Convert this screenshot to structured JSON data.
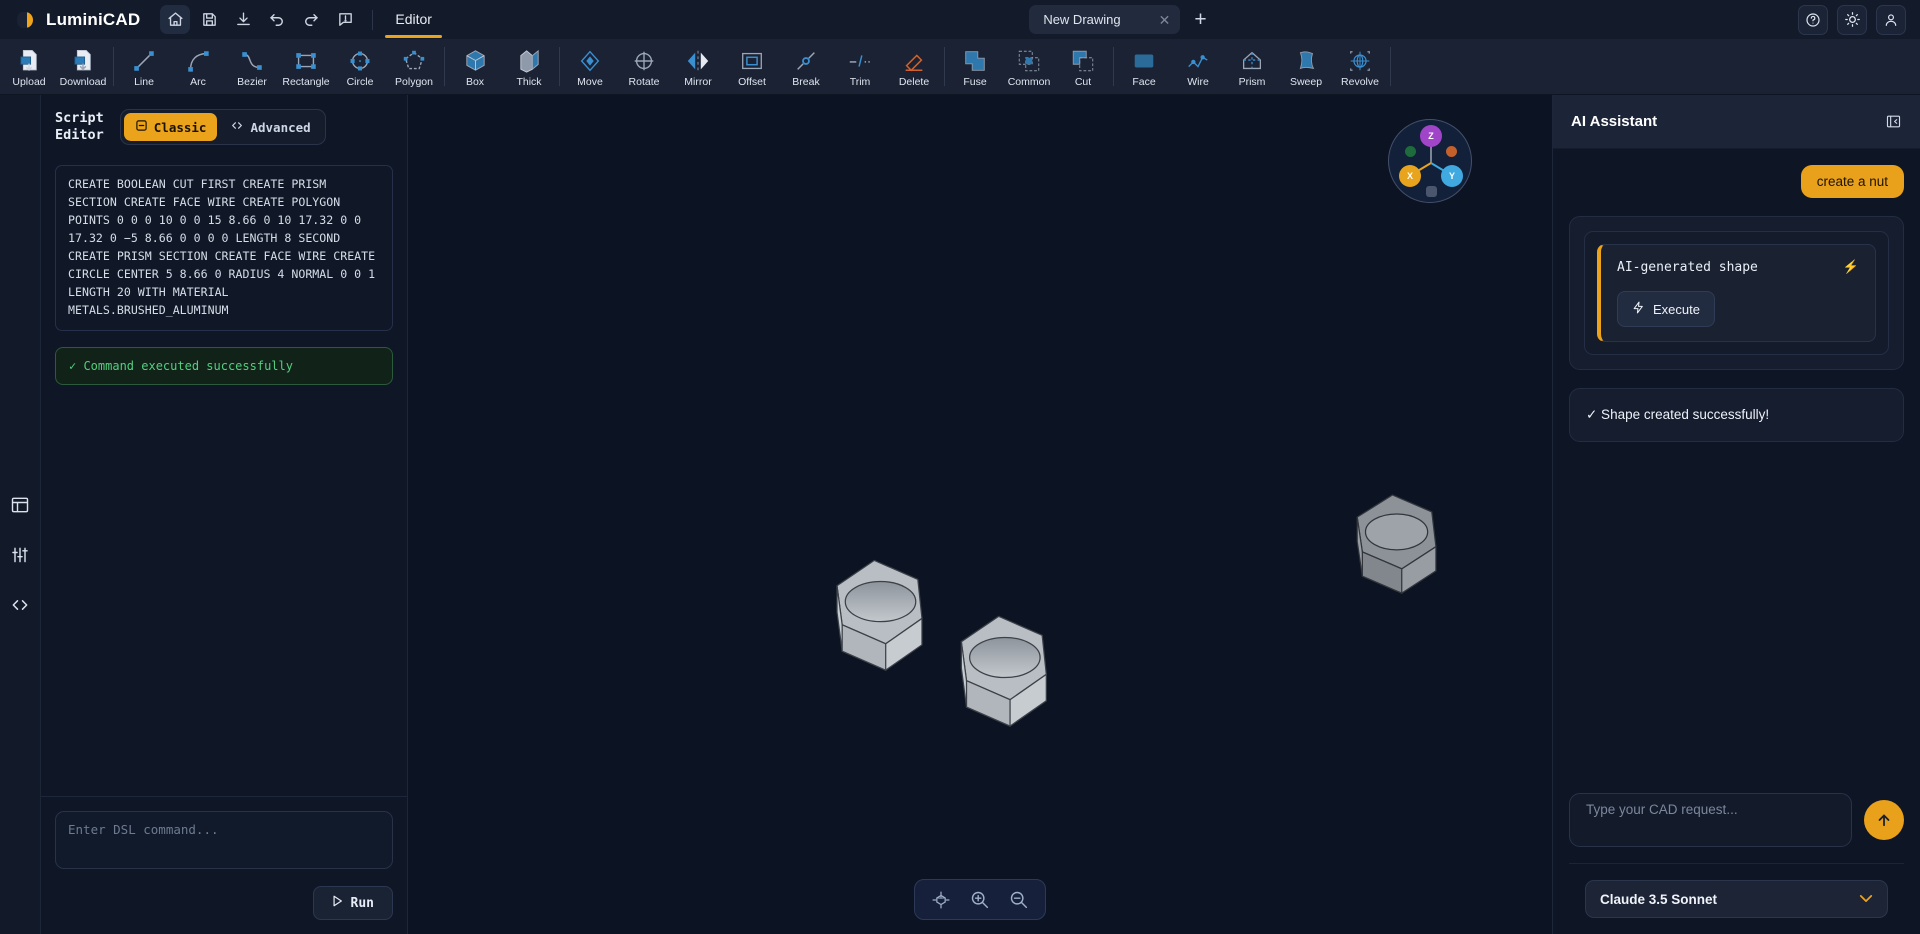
{
  "app": {
    "brand": "LuminiCAD",
    "accent": "#eba31b",
    "background": "#0d1320"
  },
  "topbar": {
    "icons": [
      {
        "name": "home-icon",
        "label": "Home"
      },
      {
        "name": "save-icon",
        "label": "Save"
      },
      {
        "name": "download-icon",
        "label": "Download"
      },
      {
        "name": "undo-icon",
        "label": "Undo"
      },
      {
        "name": "redo-icon",
        "label": "Redo"
      },
      {
        "name": "feedback-icon",
        "label": "Feedback"
      }
    ],
    "tab": "Editor",
    "document_tab": "New Drawing",
    "close_glyph": "✕",
    "new_tab_glyph": "+",
    "right_icons": [
      {
        "name": "help-icon",
        "label": "Help"
      },
      {
        "name": "theme-icon",
        "label": "Theme"
      },
      {
        "name": "account-icon",
        "label": "Account"
      }
    ]
  },
  "ribbon": {
    "groups": [
      {
        "items": [
          {
            "label": "Upload",
            "icon": "upload-icon"
          },
          {
            "label": "Download",
            "icon": "download-file-icon"
          }
        ]
      },
      {
        "items": [
          {
            "label": "Line",
            "icon": "line-icon"
          },
          {
            "label": "Arc",
            "icon": "arc-icon"
          },
          {
            "label": "Bezier",
            "icon": "bezier-icon"
          },
          {
            "label": "Rectangle",
            "icon": "rectangle-icon"
          },
          {
            "label": "Circle",
            "icon": "circle-icon"
          },
          {
            "label": "Polygon",
            "icon": "polygon-icon"
          }
        ]
      },
      {
        "items": [
          {
            "label": "Box",
            "icon": "box-icon"
          },
          {
            "label": "Thick",
            "icon": "thick-icon"
          }
        ]
      },
      {
        "items": [
          {
            "label": "Move",
            "icon": "move-icon"
          },
          {
            "label": "Rotate",
            "icon": "rotate-icon"
          },
          {
            "label": "Mirror",
            "icon": "mirror-icon"
          },
          {
            "label": "Offset",
            "icon": "offset-icon"
          },
          {
            "label": "Break",
            "icon": "break-icon"
          },
          {
            "label": "Trim",
            "icon": "trim-icon"
          },
          {
            "label": "Delete",
            "icon": "delete-icon"
          }
        ]
      },
      {
        "items": [
          {
            "label": "Fuse",
            "icon": "fuse-icon"
          },
          {
            "label": "Common",
            "icon": "common-icon"
          },
          {
            "label": "Cut",
            "icon": "cut-icon"
          }
        ]
      },
      {
        "items": [
          {
            "label": "Face",
            "icon": "face-icon"
          },
          {
            "label": "Wire",
            "icon": "wire-icon"
          },
          {
            "label": "Prism",
            "icon": "prism-icon"
          },
          {
            "label": "Sweep",
            "icon": "sweep-icon"
          },
          {
            "label": "Revolve",
            "icon": "revolve-icon"
          }
        ]
      }
    ]
  },
  "rail": {
    "items": [
      {
        "name": "layout-icon",
        "label": "Layout"
      },
      {
        "name": "sliders-icon",
        "label": "Properties"
      },
      {
        "name": "code-icon",
        "label": "Code"
      }
    ]
  },
  "script_editor": {
    "title": "Script\nEditor",
    "modes": [
      {
        "label": "Classic",
        "icon": "minus-box-icon",
        "active": true
      },
      {
        "label": "Advanced",
        "icon": "code-brackets-icon",
        "active": false
      }
    ],
    "script": "CREATE BOOLEAN CUT FIRST CREATE PRISM SECTION CREATE FACE WIRE CREATE POLYGON POINTS 0 0 0 10 0 0 15 8.66 0 10 17.32 0 0 17.32 0 −5 8.66 0 0 0 0 LENGTH 8 SECOND CREATE PRISM SECTION CREATE FACE WIRE CREATE CIRCLE CENTER 5 8.66 0 RADIUS 4 NORMAL 0 0 1 LENGTH 20 WITH MATERIAL METALS.BRUSHED_ALUMINUM",
    "status": "✓ Command executed successfully",
    "input_placeholder": "Enter DSL command...",
    "input_value": "",
    "run_label": "Run",
    "run_icon": "play-icon"
  },
  "viewport": {
    "gizmo": {
      "axes": [
        {
          "label": "Z",
          "color": "#a044c8"
        },
        {
          "label": "Y",
          "color": "#3fa9e0"
        },
        {
          "label": "X",
          "color": "#e8a41d"
        }
      ],
      "extra_dots": [
        {
          "color": "#1e6b3d"
        },
        {
          "color": "#c4602a"
        },
        {
          "color": "#49566d"
        }
      ]
    },
    "controls": [
      {
        "name": "fit-view-icon",
        "label": "Fit view"
      },
      {
        "name": "zoom-in-icon",
        "label": "Zoom in"
      },
      {
        "name": "zoom-out-icon",
        "label": "Zoom out"
      }
    ],
    "shapes_description": "three hexagonal nuts with circular through-holes"
  },
  "ai_panel": {
    "title": "AI Assistant",
    "collapse_icon": "collapse-panel-icon",
    "messages": [
      {
        "role": "user",
        "text": "create a nut"
      },
      {
        "role": "assistant",
        "card_title": "AI-generated shape",
        "execute_label": "Execute"
      },
      {
        "role": "assistant",
        "text": "✓ Shape created successfully!"
      }
    ],
    "input_placeholder": "Type your CAD request...",
    "input_value": "",
    "send_icon": "send-arrow-icon",
    "model": "Claude 3.5 Sonnet",
    "model_chevron": "⌄"
  }
}
